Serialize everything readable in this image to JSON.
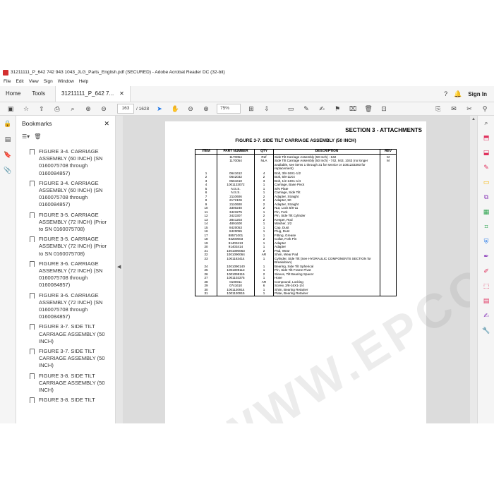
{
  "window": {
    "title": "31211111_P_642 742 943 1043_JLG_Parts_English.pdf (SECURED) - Adobe Acrobat Reader DC (32-bit)"
  },
  "menu": [
    "File",
    "Edit",
    "View",
    "Sign",
    "Window",
    "Help"
  ],
  "tabs": {
    "home": "Home",
    "tools": "Tools",
    "doc": "31211111_P_642 7...",
    "sign_in": "Sign In"
  },
  "toolbar": {
    "page_current": "163",
    "page_total": "/ 1628",
    "zoom": "75%"
  },
  "bookmarks": {
    "title": "Bookmarks",
    "items": [
      "FIGURE 3-4. CARRIAGE ASSEMBLY (60 INCH) (SN 0160075708 through 0160084857)",
      "FIGURE 3-4. CARRIAGE ASSEMBLY (60 INCH) (SN 0160075708 through 0160084857)",
      "FIGURE 3-5. CARRIAGE ASSEMBLY (72 INCH) (Prior to SN 0160075708)",
      "FIGURE 3-5. CARRIAGE ASSEMBLY (72 INCH) (Prior to SN 0160075708)",
      "FIGURE 3-6. CARRIAGE ASSEMBLY (72 INCH) (SN 0160075708 through 0160084857)",
      "FIGURE 3-6. CARRIAGE ASSEMBLY (72 INCH) (SN 0160075708 through 0160084857)",
      "FIGURE 3-7. SIDE TILT CARRIAGE ASSEMBLY (50 INCH)",
      "FIGURE 3-7. SIDE TILT CARRIAGE ASSEMBLY (50 INCH)",
      "FIGURE 3-8. SIDE TILT CARRIAGE ASSEMBLY (50 INCH)",
      "FIGURE 3-8. SIDE TILT"
    ]
  },
  "document": {
    "section": "SECTION 3 - ATTACHMENTS",
    "figure_title": "FIGURE 3-7. SIDE TILT CARRIAGE ASSEMBLY (50 INCH)",
    "headers": [
      "ITEM",
      "PART NUMBER",
      "QTY",
      "DESCRIPTION",
      "REV"
    ],
    "rows": [
      [
        "",
        "1170054",
        "Ref",
        "Side Tilt Carriage Assembly (50 Inch) - 642",
        "M"
      ],
      [
        "",
        "1170054",
        "NLA",
        "Side Tilt Carriage Assembly (50 Inch) - 742, 943, 1043 (no longer available, see items 1 through 31 for service or 1001233393 for replacement)",
        "M"
      ],
      [
        "1",
        "0641612",
        "4",
        "Bolt, 3/8-16X1-1/2",
        ""
      ],
      [
        "2",
        "0642032",
        "2",
        "Bolt, 5/8-11X4",
        ""
      ],
      [
        "3",
        "0561610",
        "3",
        "Bolt, 1/2-13X1-1/4",
        ""
      ],
      [
        "4",
        "1001133072",
        "1",
        "Carriage, Base Pivot",
        ""
      ],
      [
        "5",
        "N.S.S.",
        "1",
        "S/N Plate",
        ""
      ],
      [
        "6",
        "N.S.S.",
        "1",
        "Carriage, Side Tilt",
        ""
      ],
      [
        "7",
        "2110606",
        "2",
        "Adapter, Straight",
        ""
      ],
      [
        "8",
        "2172106",
        "2",
        "Adapter, 90",
        ""
      ],
      [
        "9",
        "2110608",
        "2",
        "Adapter, Straight",
        ""
      ],
      [
        "10",
        "3300240",
        "2",
        "Nut, Lock 5/8-11",
        ""
      ],
      [
        "11",
        "3423275",
        "1",
        "Pin, Fork",
        ""
      ],
      [
        "12",
        "3423307",
        "2",
        "Pin, Side Tilt Cylinder",
        ""
      ],
      [
        "13",
        "3841203",
        "2",
        "Keeper, Rod",
        ""
      ],
      [
        "14",
        "4891600",
        "1",
        "Washer, 1/2",
        ""
      ],
      [
        "15",
        "8420053",
        "1",
        "Cap, Dust",
        ""
      ],
      [
        "16",
        "8420055",
        "1",
        "Plug, Dust",
        ""
      ],
      [
        "17",
        "88571001",
        "1",
        "Fitting, Grease",
        ""
      ],
      [
        "18",
        "93200003",
        "2",
        "Collar, Fork Pin",
        ""
      ],
      [
        "19",
        "91403413",
        "1",
        "Adapter",
        ""
      ],
      [
        "20",
        "91403414",
        "1",
        "Adapter",
        ""
      ],
      [
        "21",
        "1001090063",
        "2",
        "Pad, Wear",
        ""
      ],
      [
        "22",
        "1001090064",
        "AR",
        "Shim, Wear Pad",
        ""
      ],
      [
        "23",
        "1001183414",
        "1",
        "Cylinder, Side Tilt (See HYDRAULIC COMPONENTS SECTION for Breakdown)",
        ""
      ],
      [
        "24",
        "1001090140",
        "1",
        "Bearing, Side Tilt Spherical",
        ""
      ],
      [
        "25",
        "1001099113",
        "1",
        "Pin, Side Tilt Frame Pivot",
        ""
      ],
      [
        "26",
        "1001099115",
        "2",
        "Sleeve, Tilt Bearing Spacer",
        ""
      ],
      [
        "27",
        "1001102375",
        "1",
        "Hose",
        ""
      ],
      [
        "28",
        "0100011",
        "AR",
        "Compound, Locking",
        ""
      ],
      [
        "29",
        "0741610",
        "6",
        "Screw, 3/8-16X1-1/4",
        ""
      ],
      [
        "30",
        "1001120914",
        "1",
        "Shim, Bearing Retainer",
        ""
      ],
      [
        "31",
        "1001120915",
        "1",
        "Plate, Bearing Retainer",
        ""
      ]
    ]
  },
  "watermark": "WWW.EPCCDOPO.COM"
}
